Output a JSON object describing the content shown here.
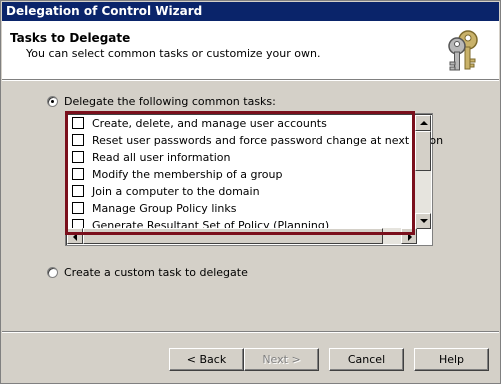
{
  "window": {
    "title": "Delegation of Control Wizard"
  },
  "header": {
    "title": "Tasks to Delegate",
    "subtitle": "You can select common tasks or customize your own.",
    "icon": "keys-icon"
  },
  "options": {
    "common": {
      "label": "Delegate the following common tasks:",
      "selected": true
    },
    "custom": {
      "label": "Create a custom task to delegate",
      "selected": false
    }
  },
  "tasks": [
    {
      "label": "Create, delete, and manage user accounts",
      "checked": false
    },
    {
      "label": "Reset user passwords and force password change at next logon",
      "checked": false
    },
    {
      "label": "Read all user information",
      "checked": false
    },
    {
      "label": "Modify the membership of a group",
      "checked": false
    },
    {
      "label": "Join a computer to the domain",
      "checked": false
    },
    {
      "label": "Manage Group Policy links",
      "checked": false
    },
    {
      "label": "Generate Resultant Set of Policy (Planning)",
      "checked": false
    }
  ],
  "buttons": {
    "back": "< Back",
    "next": "Next >",
    "cancel": "Cancel",
    "help": "Help"
  },
  "colors": {
    "titlebar": "#0a246a",
    "highlight_border": "#7a0f1c",
    "face": "#d4d0c8"
  }
}
